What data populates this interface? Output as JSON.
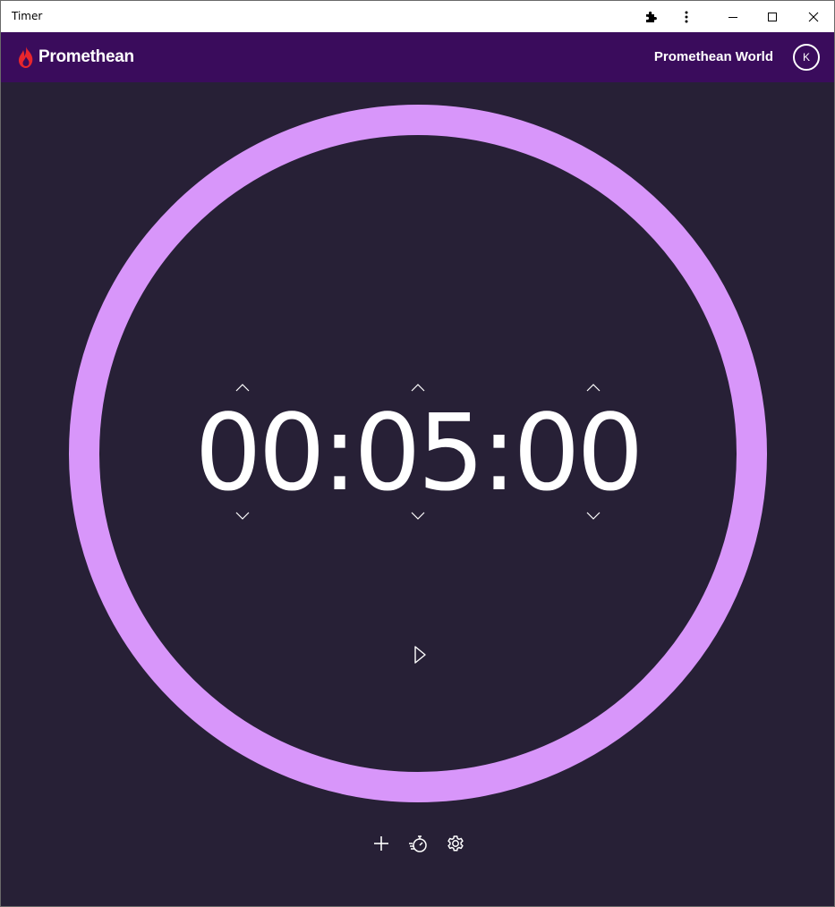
{
  "window": {
    "title": "Timer"
  },
  "header": {
    "brand": "Promethean",
    "world_link": "Promethean World",
    "avatar_initial": "K"
  },
  "timer": {
    "hours": "00",
    "minutes": "05",
    "seconds": "00",
    "separator": ":",
    "progress": 1.0
  },
  "colors": {
    "ring": "#d896fa",
    "background": "#272036",
    "appbar": "#3a0c5c",
    "logo_flame": "#e8262c"
  },
  "icons": {
    "extensions": "puzzle-icon",
    "more": "more-vertical-icon",
    "minimize": "minimize-icon",
    "maximize": "maximize-icon",
    "close": "close-icon",
    "play": "play-icon",
    "add": "plus-icon",
    "quick_timer": "stopwatch-icon",
    "settings": "gear-icon"
  }
}
